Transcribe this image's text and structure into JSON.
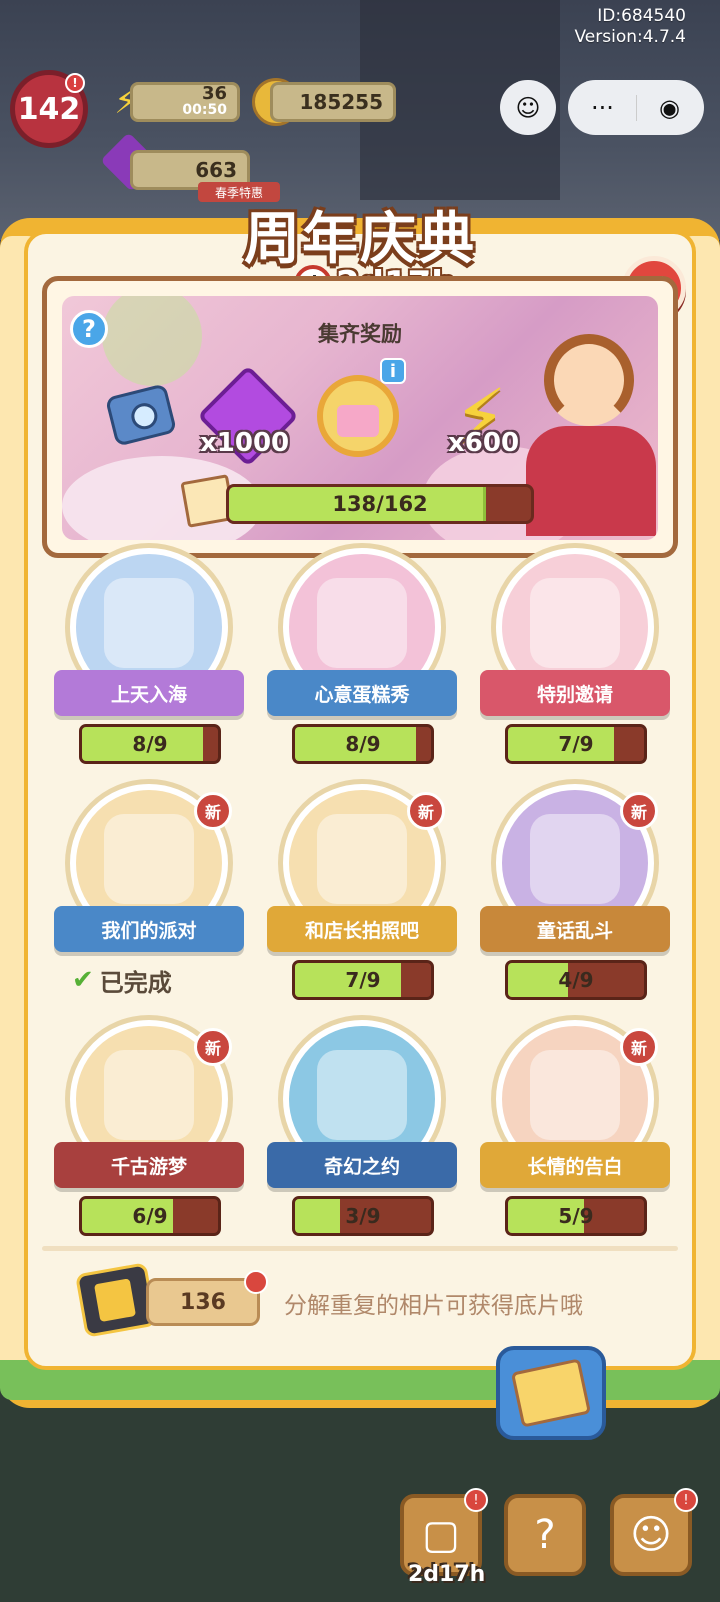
{
  "hud": {
    "id_text": "ID:684540",
    "version_text": "Version:4.7.4",
    "level": "142",
    "energy": "36",
    "energy_timer": "00:50",
    "coins": "185255",
    "gems": "663",
    "season_tag": "春季特惠",
    "miniprogram_more": "···",
    "miniprogram_close": "◉"
  },
  "event": {
    "title": "周年庆典",
    "timer": "2d17h",
    "collect_label": "集齐奖励",
    "rewards": [
      {
        "icon": "camera-icon",
        "count": ""
      },
      {
        "icon": "gem-icon",
        "count": "x1000"
      },
      {
        "icon": "cake-icon",
        "count": ""
      },
      {
        "icon": "energy-bolt-icon",
        "count": "x600"
      }
    ],
    "progress_text": "138/162",
    "progress_value": 138,
    "progress_max": 162
  },
  "albums": [
    {
      "name": "上天入海",
      "progress": "8/9",
      "current": 8,
      "total": 9,
      "is_new": false,
      "completed": false,
      "ribbon_color": "#b37ad8",
      "circle_color": "#bcd6f2"
    },
    {
      "name": "心意蛋糕秀",
      "progress": "8/9",
      "current": 8,
      "total": 9,
      "is_new": false,
      "completed": false,
      "ribbon_color": "#4a88c8",
      "circle_color": "#f3c2d8"
    },
    {
      "name": "特别邀请",
      "progress": "7/9",
      "current": 7,
      "total": 9,
      "is_new": false,
      "completed": false,
      "ribbon_color": "#d9576a",
      "circle_color": "#f7cfd8"
    },
    {
      "name": "我们的派对",
      "progress": "",
      "current": 9,
      "total": 9,
      "is_new": true,
      "completed": true,
      "ribbon_color": "#4a88c8",
      "circle_color": "#f6dfb0"
    },
    {
      "name": "和店长拍照吧",
      "progress": "7/9",
      "current": 7,
      "total": 9,
      "is_new": true,
      "completed": false,
      "ribbon_color": "#e0a838",
      "circle_color": "#f6dfb0"
    },
    {
      "name": "童话乱斗",
      "progress": "4/9",
      "current": 4,
      "total": 9,
      "is_new": true,
      "completed": false,
      "ribbon_color": "#c8883a",
      "circle_color": "#c9b2e4"
    },
    {
      "name": "千古游梦",
      "progress": "6/9",
      "current": 6,
      "total": 9,
      "is_new": true,
      "completed": false,
      "ribbon_color": "#a8403e",
      "circle_color": "#f6dfb0"
    },
    {
      "name": "奇幻之约",
      "progress": "3/9",
      "current": 3,
      "total": 9,
      "is_new": false,
      "completed": false,
      "ribbon_color": "#3a6aa8",
      "circle_color": "#8cc8e4"
    },
    {
      "name": "长情的告白",
      "progress": "5/9",
      "current": 5,
      "total": 9,
      "is_new": true,
      "completed": false,
      "ribbon_color": "#e0a838",
      "circle_color": "#f6d4c0"
    }
  ],
  "labels": {
    "new_badge": "新",
    "completed": "已完成",
    "help": "?",
    "info": "i",
    "close": "✕"
  },
  "footer": {
    "film_count": "136",
    "hint": "分解重复的相片可获得底片哦"
  },
  "bottom_bar": {
    "timer": "2d17h"
  }
}
